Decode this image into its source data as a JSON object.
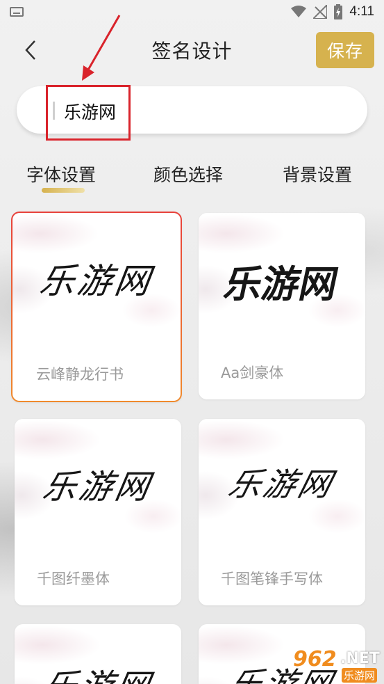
{
  "status_bar": {
    "time": "4:11"
  },
  "header": {
    "back_icon": "chevron-left-icon",
    "title": "签名设计",
    "save_label": "保存",
    "save_color": "#d6b24e"
  },
  "name_input": {
    "value": "乐游网"
  },
  "tabs": [
    {
      "label": "字体设置",
      "active": true
    },
    {
      "label": "颜色选择",
      "active": false
    },
    {
      "label": "背景设置",
      "active": false
    }
  ],
  "fonts": [
    {
      "preview": "乐游网",
      "name": "云峰静龙行书",
      "selected": true
    },
    {
      "preview": "乐游网",
      "name": "Aa剑豪体",
      "selected": false
    },
    {
      "preview": "乐游网",
      "name": "千图纤墨体",
      "selected": false
    },
    {
      "preview": "乐游网",
      "name": "千图笔锋手写体",
      "selected": false
    },
    {
      "preview": "乐游网",
      "selected": false
    },
    {
      "preview": "乐游网",
      "selected": false
    }
  ],
  "watermark": {
    "number": "962",
    "suffix": ".NET",
    "sub": "乐游网"
  },
  "colors": {
    "accent": "#d6b24e",
    "selected_border_top": "#e8413b",
    "selected_border_bottom": "#f08a2c",
    "annotation_red": "#d9232b"
  }
}
